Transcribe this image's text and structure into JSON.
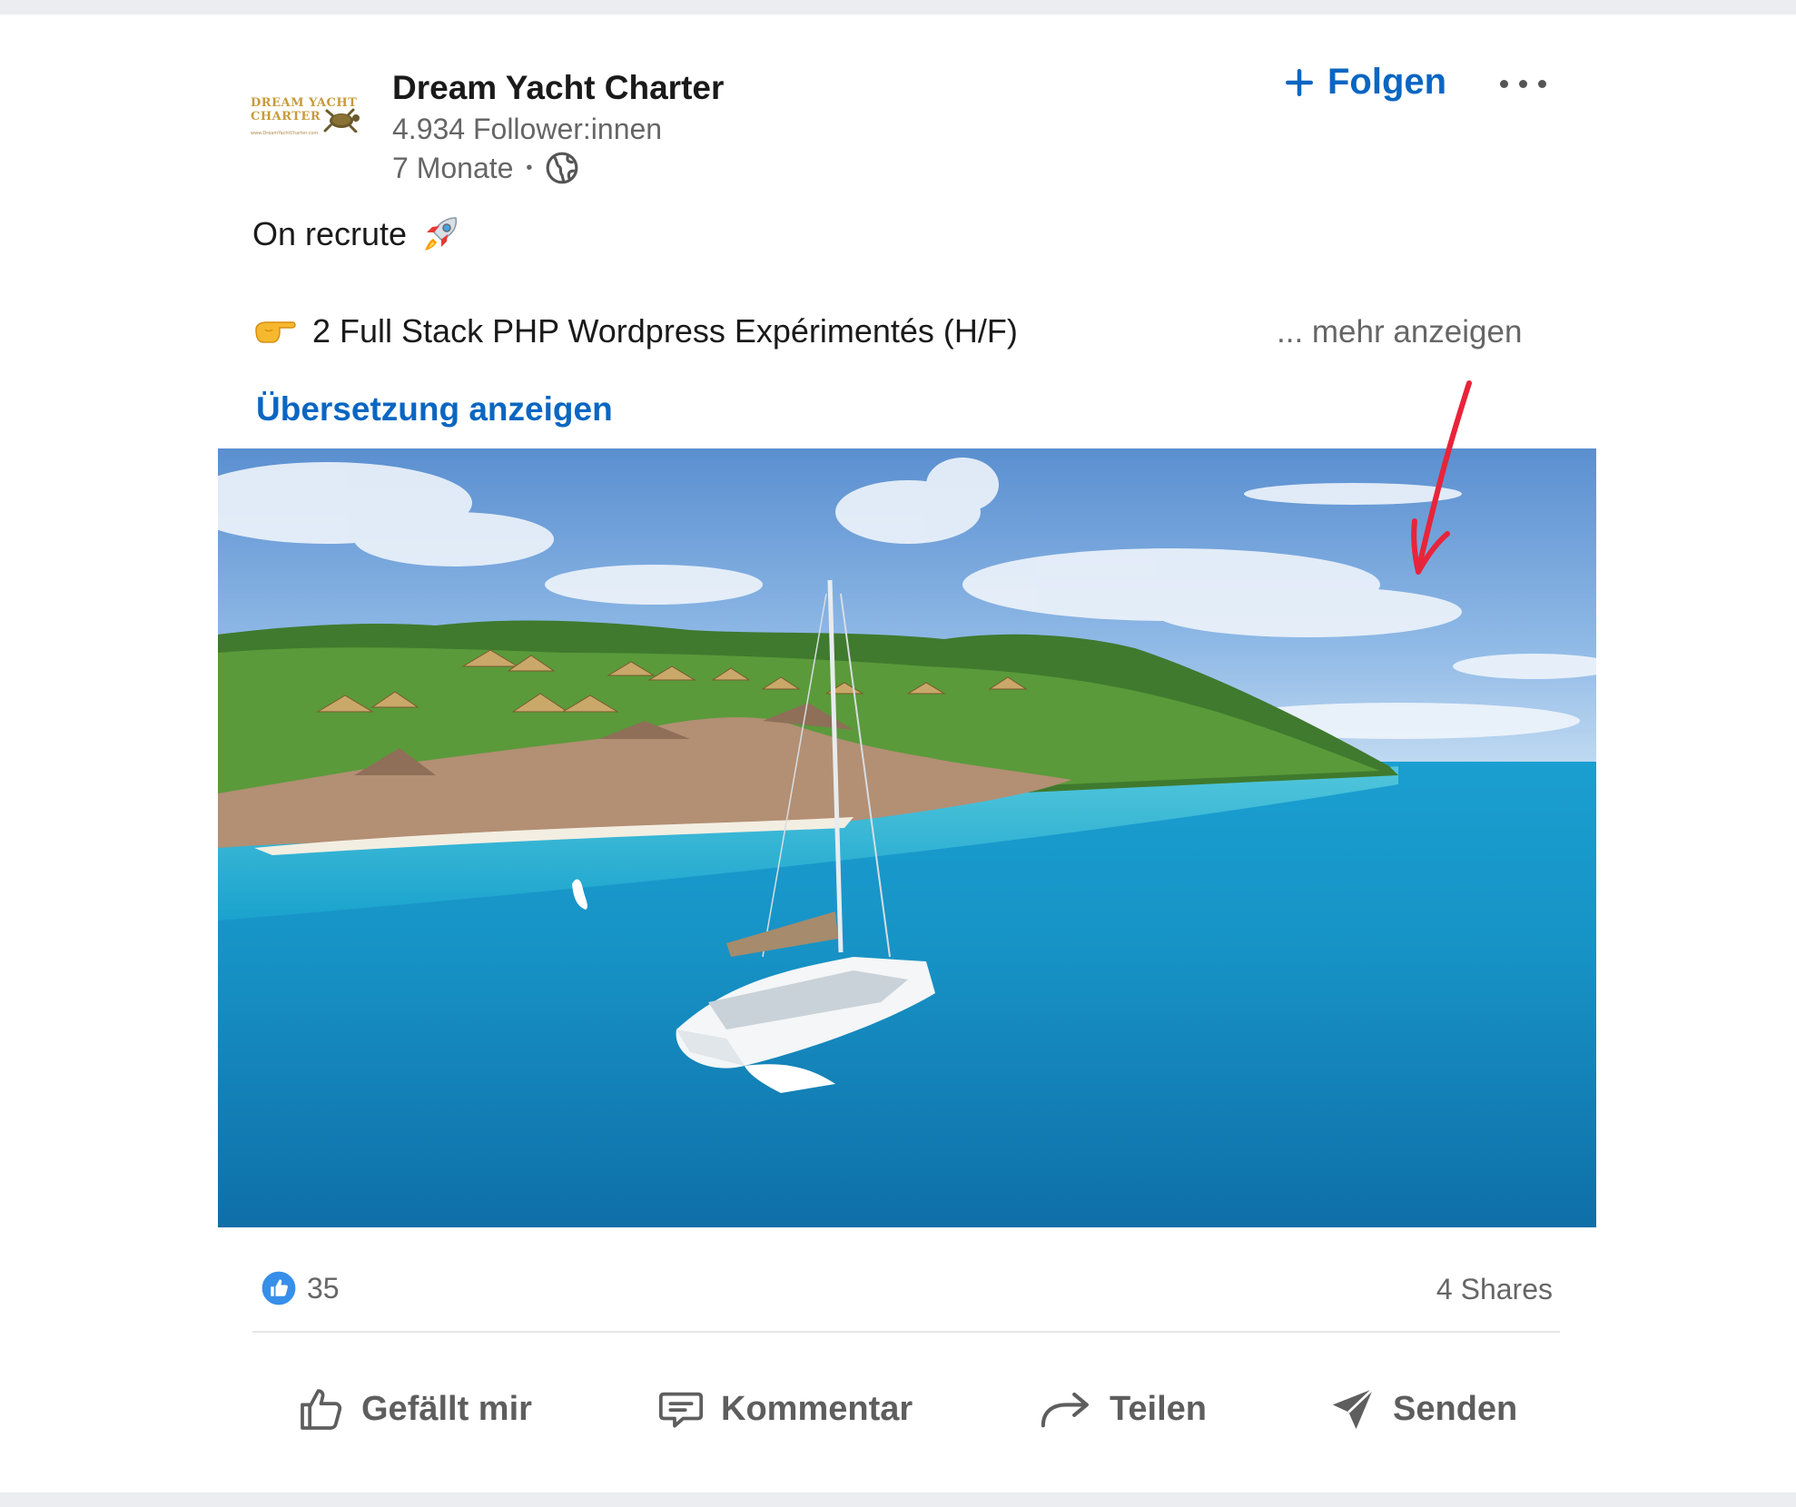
{
  "post": {
    "company_name": "Dream Yacht Charter",
    "followers": "4.934 Follower:innen",
    "time_ago": "7 Monate",
    "separator": "•",
    "follow_label": "Folgen",
    "line1": "On recrute",
    "line2": "2 Full Stack PHP Wordpress Expérimentés (H/F)",
    "see_more": "... mehr anzeigen",
    "translate": "Übersetzung anzeigen"
  },
  "logo": {
    "line1": "DREAM YACHT",
    "line2": "CHARTER",
    "url": "www.DreamYachtCharter.com"
  },
  "stats": {
    "reactions": "35",
    "shares": "4 Shares"
  },
  "actions": {
    "like": "Gefällt mir",
    "comment": "Kommentar",
    "share": "Teilen",
    "send": "Senden"
  },
  "icons": {
    "follow": "plus-icon",
    "more": "ellipsis-icon",
    "visibility": "globe-icon",
    "line1_emoji": "rocket-emoji",
    "line2_emoji": "pointing-hand-emoji",
    "reaction": "like-reaction-icon",
    "annotation": "red-arrow-annotation"
  },
  "colors": {
    "brand_blue": "#0a66c2",
    "annotation_red": "#e8243a",
    "text_secondary": "#666666"
  }
}
